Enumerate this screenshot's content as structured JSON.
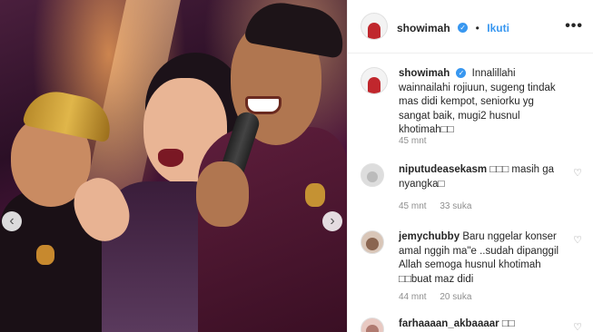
{
  "post": {
    "username": "showimah",
    "follow_label": "Ikuti",
    "more_icon": "•••"
  },
  "photo": {
    "prev_arrow": "‹",
    "next_arrow": "›"
  },
  "caption": {
    "username": "showimah",
    "text": "Innalillahi wainnailahi rojiuun, sugeng tindak mas didi kempot, seniorku yg sangat baik, mugi2 husnul khotimah□□",
    "time": "45 mnt"
  },
  "comments": [
    {
      "username": "niputudeasekasm",
      "text": "□□□ masih ga nyangka□",
      "time": "45 mnt",
      "likes": "33 suka"
    },
    {
      "username": "jemychubby",
      "text": "Baru nggelar konser amal nggih ma\"e ..sudah dipanggil Allah semoga husnul khotimah □□buat maz didi",
      "time": "44 mnt",
      "likes": "20 suka"
    },
    {
      "username": "farhaaaan_akbaaaar",
      "text": "□□",
      "time": "",
      "likes": ""
    }
  ],
  "icons": {
    "heart": "♡",
    "verified": "✓"
  },
  "colors": {
    "accent": "#3897f0",
    "muted": "#8e8e8e"
  }
}
